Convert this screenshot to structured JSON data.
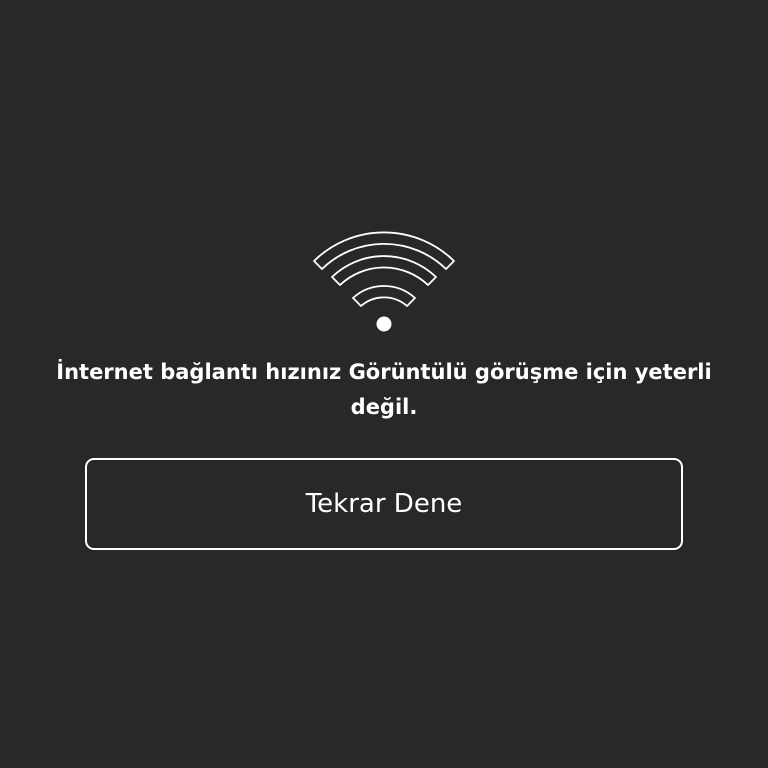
{
  "error": {
    "icon": "wifi-icon",
    "message": "İnternet bağlantı hızınız Görüntülü görüşme için yeterli değil.",
    "retry_label": "Tekrar Dene"
  },
  "colors": {
    "background": "#282828",
    "foreground": "#ffffff"
  }
}
